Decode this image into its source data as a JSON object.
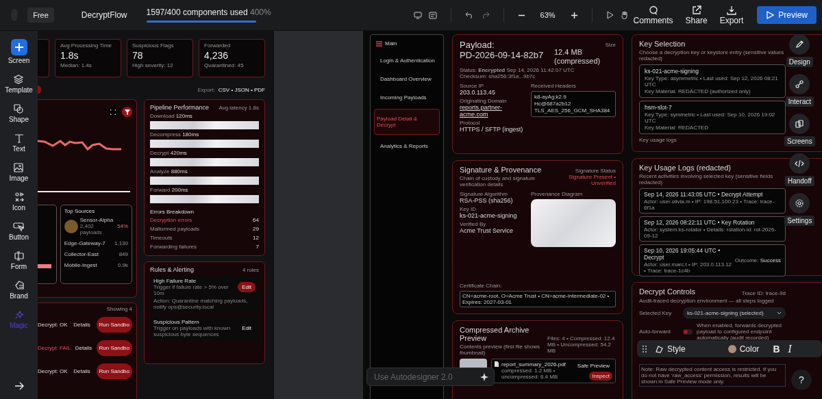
{
  "topbar": {
    "plan": "Free",
    "project": "DecryptFlow",
    "usage": {
      "text": "1597/400 components used",
      "percent": "400%",
      "level": 1
    },
    "zoom": "63%",
    "actions": [
      {
        "label": "Comments",
        "kind": "comments"
      },
      {
        "label": "Share",
        "kind": "share"
      },
      {
        "label": "Export",
        "kind": "export"
      }
    ],
    "preview": "Preview"
  },
  "tools": [
    {
      "label": "Screen",
      "kind": "add"
    },
    {
      "label": "Template",
      "kind": "layers"
    },
    {
      "label": "Shape",
      "kind": "shape"
    },
    {
      "label": "Text",
      "kind": "text"
    },
    {
      "label": "Image",
      "kind": "image"
    },
    {
      "label": "Icon",
      "kind": "icon"
    },
    {
      "label": "Button",
      "kind": "button"
    },
    {
      "label": "Form",
      "kind": "form"
    },
    {
      "label": "Brand",
      "kind": "brand"
    },
    {
      "label": "Magic",
      "kind": "magic"
    }
  ],
  "dashboard": {
    "stats": [
      {
        "label": "Avg Processing Time",
        "value": "1.8s",
        "note": "Median: 1.4s"
      },
      {
        "label": "Suspicious Flags",
        "value": "78",
        "note": "High severity: 12"
      },
      {
        "label": "Forwarded",
        "value": "4,236",
        "note": "Quarantined: 45"
      }
    ],
    "export_label": "Export:",
    "export_formats": "CSV • JSON • PDF",
    "top_sources": {
      "title": "Top Sources",
      "items": [
        {
          "name": "Sensor-Alpha",
          "sub": "2,402 payloads",
          "value": "54%",
          "kind": "featured"
        },
        {
          "name": "Edge-Gateway-7",
          "value": "1,130",
          "kind": "plain"
        },
        {
          "name": "Collector-East",
          "value": "849",
          "kind": "plain"
        },
        {
          "name": "Mobile-Ingest",
          "value": "0.9k",
          "kind": "plain"
        }
      ]
    },
    "jobs": {
      "count": "Showing 4",
      "rows": [
        {
          "status": "Decrypt: OK",
          "failed": false,
          "details": "Details",
          "action": "Run Sandbo"
        },
        {
          "status": "Decrypt: FAIL",
          "failed": true,
          "details": "Details",
          "action": "Run Sandbo"
        },
        {
          "status": "Decrypt: OK",
          "failed": false,
          "details": "Details",
          "action": "Run Sandbo"
        }
      ]
    },
    "pipeline": {
      "title": "Pipeline Performance",
      "note": "Avg latency 1.8s",
      "stages": [
        {
          "name": "Download",
          "time": "120ms"
        },
        {
          "name": "Decompress",
          "time": "180ms"
        },
        {
          "name": "Decrypt",
          "time": "420ms"
        },
        {
          "name": "Analyze",
          "time": "880ms"
        },
        {
          "name": "Forward",
          "time": "200ms"
        }
      ],
      "errors_title": "Errors Breakdown",
      "errors": [
        {
          "label": "Decryption errors",
          "count": "64",
          "alert": true
        },
        {
          "label": "Malformed payloads",
          "count": "29",
          "alert": false
        },
        {
          "label": "Timeouts",
          "count": "12",
          "alert": false
        },
        {
          "label": "Forwarding failures",
          "count": "7",
          "alert": false
        }
      ]
    },
    "rules": {
      "title": "Rules & Alerting",
      "count": "4 rules",
      "items": [
        {
          "name": "High Failure Rate",
          "trigger": "Trigger if failure rate > 5% over 10m",
          "action": "Action: Quarantine matching payloads, notify ops@security.local",
          "button": "Edit",
          "primary": true
        },
        {
          "name": "Suspicious Pattern",
          "trigger": "Trigger on payloads with known suspicious byte sequences",
          "button": "Edit",
          "primary": false
        }
      ]
    }
  },
  "detail": {
    "nav": {
      "title": "Main",
      "items": [
        {
          "label": "Login & Authentication",
          "selected": false
        },
        {
          "label": "Dashboard Overview",
          "selected": false
        },
        {
          "label": "Incoming Payloads",
          "selected": false
        },
        {
          "label": "Payload Detail & Decrypt",
          "selected": true
        },
        {
          "label": "Analytics & Reports",
          "selected": false
        }
      ]
    },
    "payload": {
      "heading": "Payload:",
      "id": "PD-2026-09-14-82b7",
      "status": "Status: **Encrypted** Sep 14, 2026 11:42:07 UTC",
      "size_label": "Size",
      "size": "12.4 MB (compressed)",
      "checksum": "Checksum: sha256:3f1a...9b7c",
      "fields": [
        {
          "label": "Source IP",
          "value": "203.0.113.45",
          "kind": "text"
        },
        {
          "label": "Originating Domain",
          "value": "reports.partner-acme.com",
          "kind": "link"
        },
        {
          "label": "Protocol",
          "value": "HTTPS / SFTP (ingest)",
          "kind": "text"
        }
      ],
      "headers_label": "Received Headers",
      "headers": [
        "k8-ayAg:k2.9",
        "Hc@687a2b12",
        "TLS_AES_256_GCM_SHA384"
      ]
    },
    "signature": {
      "title": "Signature & Provenance",
      "subtitle": "Chain of custody and signature verification details",
      "status_label": "Signature Status",
      "status": "Signature Present • Unverified",
      "fields": [
        {
          "label": "Signature Algorithm",
          "value": "RSA-PSS (sha256)"
        },
        {
          "label": "Key ID",
          "value": "ks-021-acme-signing"
        },
        {
          "label": "Verified By",
          "value": "Acme Trust Service"
        }
      ],
      "diagram_label": "Provenance Diagram",
      "chain_label": "Certificate Chain:",
      "chain": "CN=acme-root, O=Acme Trust • CN=acme-intermediate-02 • Expires: 2027-03-01"
    },
    "archive": {
      "title": "Compressed Archive Preview",
      "subtitle": "Contents preview (first file shows thumbnail)",
      "summary": "Files: 4 • Compressed: 12.4 MB • Uncompressed: 54.2 MB",
      "file": {
        "name": "report_summary_2026.pdf",
        "meta": "compressed: 1.2 MB • uncompressed: 6.4 MB",
        "actions": [
          {
            "label": "Safe Preview",
            "primary": false
          },
          {
            "label": "Inspect",
            "primary": true
          }
        ]
      }
    },
    "keys": {
      "title": "Key Selection",
      "subtitle": "Choose a decryption key or keystore entry (sensitive values redacted)",
      "items": [
        {
          "name": "ks-021-acme-signing",
          "type": "Key Type: asymmetric • Last used: Sep 12, 2026 08:21 UTC",
          "material": "Key Material: REDACTED (authorized only)"
        },
        {
          "name": "hsm-slot-7",
          "type": "Key Type: symmetric • Last used: Sep 10, 2026 19:02 UTC",
          "material": "Key Material: REDACTED"
        }
      ],
      "footer": "Key usage logs"
    },
    "logs": {
      "title": "Key Usage Logs (redacted)",
      "subtitle": "Recent activities involving selected key (sensitive fields redacted)",
      "items": [
        {
          "event": "Sep 14, 2026 11:43:05 UTC • Decrypt Attempt",
          "detail": "Actor: user.olivia.m • IP: 198.51.100.23 • Trace: trace-6f1a"
        },
        {
          "event": "Sep 12, 2026 08:22:11 UTC • Key Rotation",
          "detail": "Actor: system.ks-rotator • Details: rotation-id: rot-2026-09-12"
        },
        {
          "event": "Sep 10, 2026 19:05:44 UTC • Decrypt",
          "detail": "Actor: user.marc.t • IP: 203.0.113.12 • Trace: trace-1c4b",
          "outcome_label": "Outcome:",
          "outcome": "Success"
        }
      ]
    },
    "controls": {
      "title": "Decrypt Controls",
      "trace": "Trace ID: trace-9d",
      "subtitle": "Audit-traced decryption environment — all steps logged",
      "selected_key_label": "Selected Key",
      "selected_key": "ks-021-acme-signing (selected)",
      "auto_forward_label": "Auto-forward",
      "auto_forward_on": false,
      "auto_forward_help": "When enabled, forwards decrypted payload to configured endpoint automatically (audit recorded)",
      "note": "Note: Raw decrypted content access is restricted. If you do not have 'raw_access' permission, results will be shown in Safe Preview mode only."
    }
  },
  "rail": [
    {
      "label": "Design",
      "kind": "design"
    },
    {
      "label": "Interact",
      "kind": "interact"
    },
    {
      "label": "Screens",
      "kind": "screens"
    },
    {
      "label": "Handoff",
      "kind": "handoff"
    },
    {
      "label": "Settings",
      "kind": "settings"
    }
  ],
  "format_bar": {
    "items": [
      {
        "label": "Style",
        "kind": "style"
      },
      {
        "label": "Color",
        "kind": "color"
      }
    ],
    "bold": "B",
    "italic": "I"
  },
  "autodesigner": {
    "placeholder": "Use Autodesigner 2.0"
  },
  "help": "?"
}
